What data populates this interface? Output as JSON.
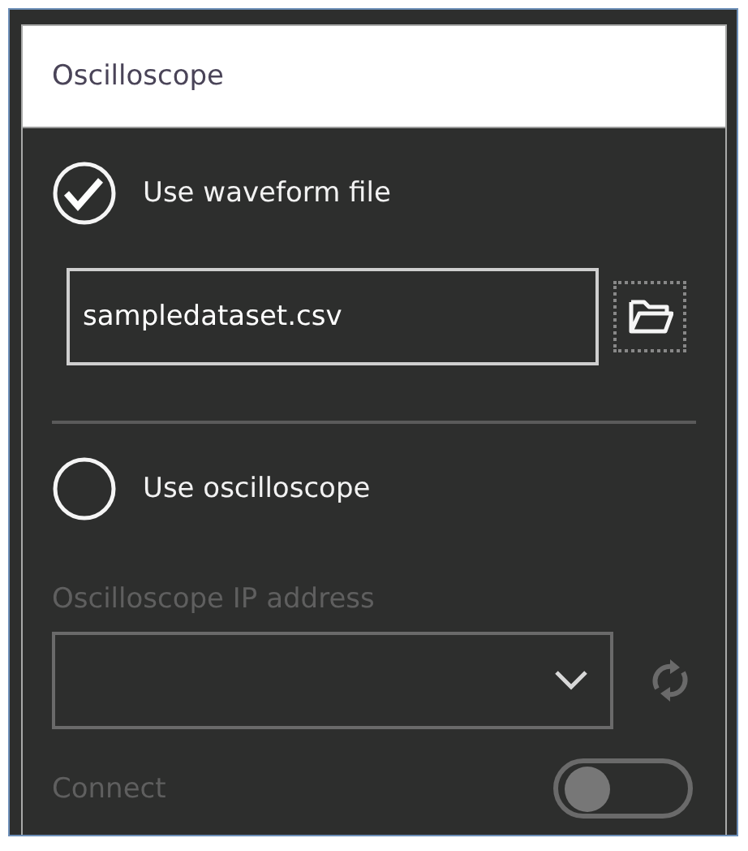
{
  "panel": {
    "title": "Oscilloscope"
  },
  "sources": [
    {
      "label": "Use waveform file",
      "selected": true
    },
    {
      "label": "Use oscilloscope",
      "selected": false
    }
  ],
  "file": {
    "value": "sampledataset.csv"
  },
  "ip_address": {
    "label": "Oscilloscope IP address",
    "disabled": true
  },
  "connect": {
    "label": "Connect",
    "on": false,
    "disabled": true
  }
}
